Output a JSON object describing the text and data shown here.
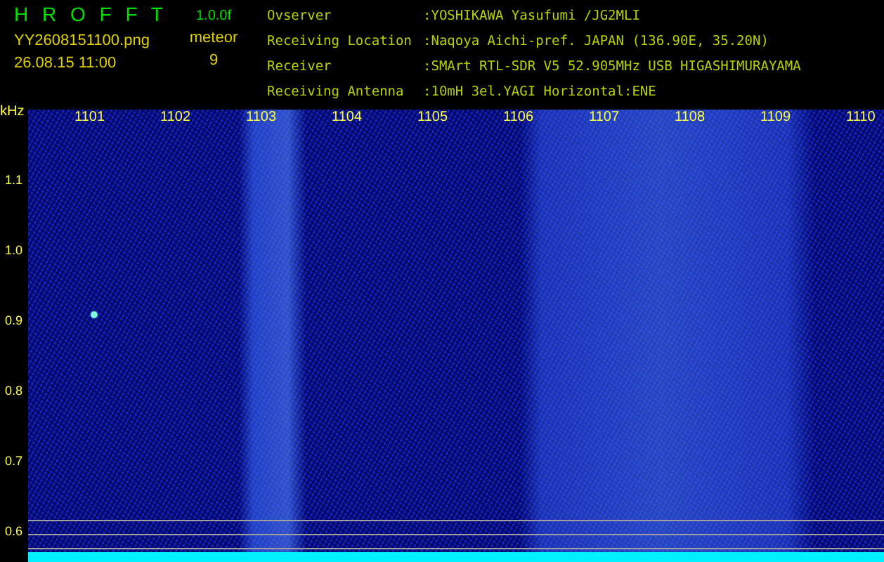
{
  "header": {
    "program_title": "H R O F F T",
    "version": "1.0.0f",
    "file_name": "YY2608151100.png",
    "timestamp": "26.08.15 11:00",
    "detection_label": "meteor",
    "detection_count": "9"
  },
  "station_info": [
    {
      "label": "Ovserver",
      "value": ":YOSHIKAWA Yasufumi /JG2MLI"
    },
    {
      "label": "Receiving Location",
      "value": ":Naqoya Aichi-pref. JAPAN (136.90E, 35.20N)"
    },
    {
      "label": "Receiver",
      "value": ":SMArt RTL-SDR V5 52.905MHz USB HIGASHIMURAYAMA"
    },
    {
      "label": "Receiving Antenna",
      "value": ":10mH 3el.YAGI Horizontal:ENE"
    }
  ],
  "spectrogram": {
    "y_unit": "kHz",
    "time_labels": [
      "1101",
      "1102",
      "1103",
      "1104",
      "1105",
      "1106",
      "1107",
      "1108",
      "1109",
      "1110"
    ],
    "frequency_labels": [
      "1.1",
      "1.0",
      "0.9",
      "0.8",
      "0.7",
      "0.6"
    ]
  }
}
